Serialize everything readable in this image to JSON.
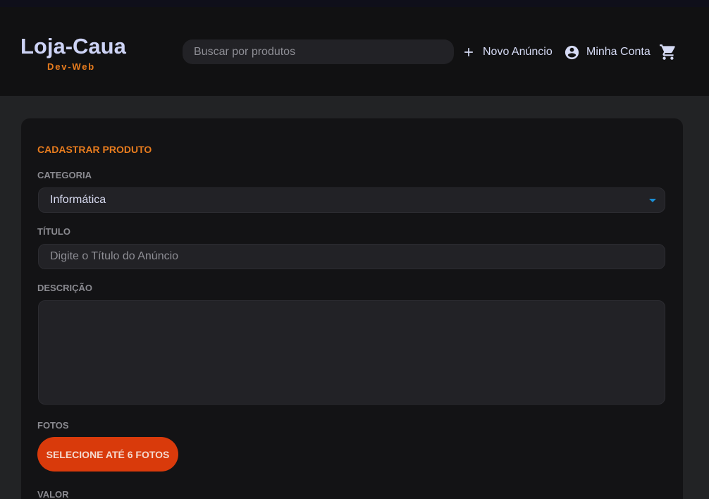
{
  "header": {
    "brand_title": "Loja-Caua",
    "brand_subtitle": "Dev-Web",
    "search_placeholder": "Buscar por produtos",
    "new_ad_label": "Novo Anúncio",
    "account_label": "Minha Conta",
    "icons": {
      "new_ad": "plus-icon",
      "account": "account-circle-icon",
      "cart": "cart-icon"
    }
  },
  "form": {
    "title": "CADASTRAR PRODUTO",
    "category_label": "CATEGORIA",
    "category_value": "Informática",
    "title_label": "TÍTULO",
    "title_placeholder": "Digite o Título do Anúncio",
    "description_label": "DESCRIÇÃO",
    "photos_label": "FOTOS",
    "photos_button": "SELECIONE ATÉ 6 FOTOS",
    "value_label": "VALOR"
  },
  "colors": {
    "accent_orange": "#e87c1e",
    "button_red": "#d93a0b",
    "select_caret": "#1a8fd6",
    "brand_text": "#cdd3f5"
  }
}
